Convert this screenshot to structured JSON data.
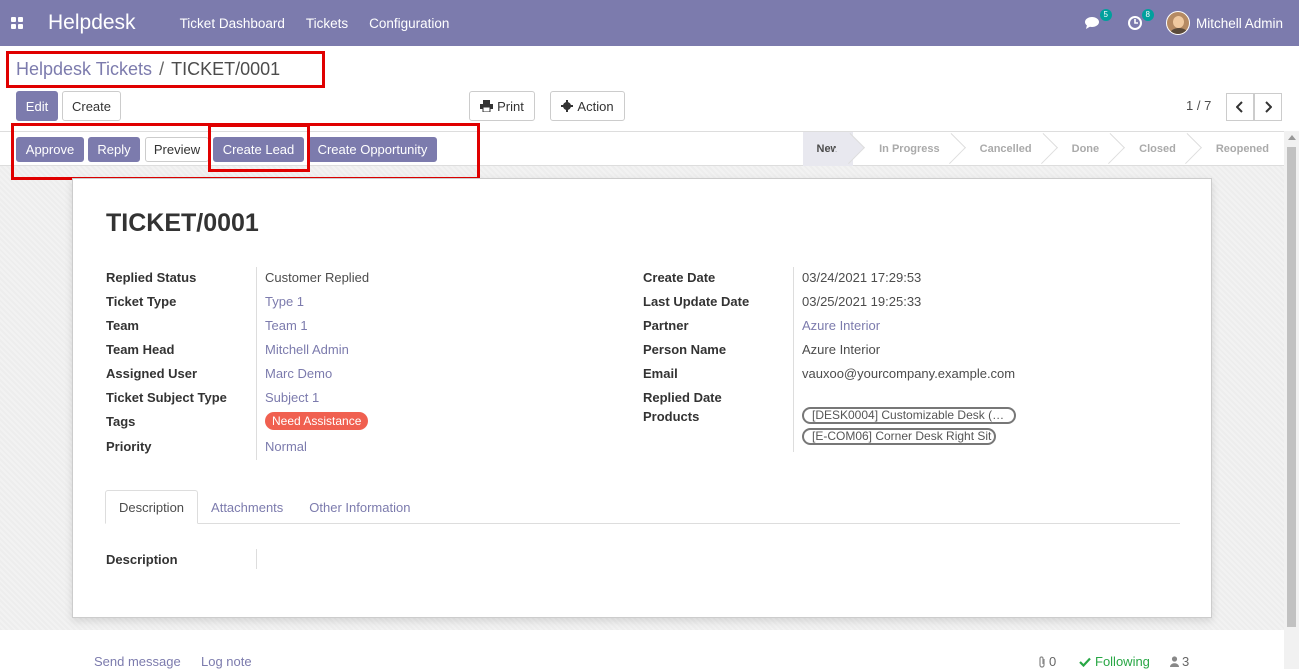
{
  "navbar": {
    "brand": "Helpdesk",
    "menu": [
      "Ticket Dashboard",
      "Tickets",
      "Configuration"
    ],
    "chat_count": "5",
    "activity_count": "8",
    "user": "Mitchell Admin"
  },
  "breadcrumb": {
    "parent": "Helpdesk Tickets",
    "separator": "/",
    "current": "TICKET/0001"
  },
  "control": {
    "edit": "Edit",
    "create": "Create",
    "print": "Print",
    "action": "Action",
    "pager": "1 / 7"
  },
  "statusbar": {
    "buttons": [
      "Approve",
      "Reply",
      "Preview",
      "Create Lead",
      "Create Opportunity"
    ],
    "stages": [
      "New",
      "In Progress",
      "Cancelled",
      "Done",
      "Closed",
      "Reopened"
    ],
    "active_stage": "New"
  },
  "ticket": {
    "title": "TICKET/0001",
    "left": {
      "labels": [
        "Replied Status",
        "Ticket Type",
        "Team",
        "Team Head",
        "Assigned User",
        "Ticket Subject Type",
        "Tags",
        "Priority"
      ],
      "values": [
        "Customer Replied",
        "Type 1",
        "Team 1",
        "Mitchell Admin",
        "Marc Demo",
        "Subject 1",
        "Need Assistance",
        "Normal"
      ]
    },
    "right": {
      "labels": [
        "Create Date",
        "Last Update Date",
        "Partner",
        "Person Name",
        "Email",
        "Replied Date",
        "Products"
      ],
      "values": [
        "03/24/2021 17:29:53",
        "03/25/2021 19:25:33",
        "Azure Interior",
        "Azure Interior",
        "vauxoo@yourcompany.example.com",
        ""
      ],
      "products": [
        "[DESK0004] Customizable Desk (…",
        "[E-COM06] Corner Desk Right Sit"
      ]
    },
    "tabs": [
      "Description",
      "Attachments",
      "Other Information"
    ],
    "description_label": "Description"
  },
  "chatter": {
    "send_message": "Send message",
    "log_note": "Log note",
    "attachments": "0",
    "following": "Following",
    "followers": "3"
  },
  "colors": {
    "primary": "#7c7bad",
    "highlight": "#e00000",
    "tag": "#f06050",
    "success": "#28a745"
  }
}
